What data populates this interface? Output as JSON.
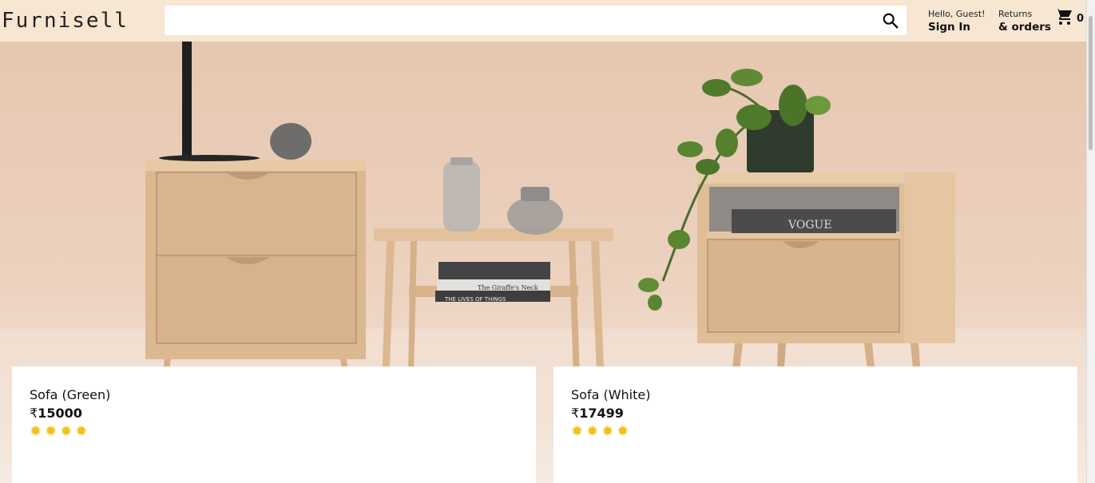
{
  "header": {
    "logo": "Furnisell",
    "search": {
      "value": "",
      "placeholder": ""
    },
    "signin": {
      "line1": "Hello, Guest!",
      "line2": "Sign In"
    },
    "returns": {
      "line1": "Returns",
      "line2": "& orders"
    },
    "cart": {
      "count": "0"
    }
  },
  "hero": {
    "books_a": "THE LIVES OF THINGS",
    "books_b": "The Giraffe's Neck",
    "magazine": "VOGUE"
  },
  "products": [
    {
      "title": "Sofa (Green)",
      "currency": "₹",
      "price": "15000",
      "rating_icons": [
        "sun-star",
        "sun-star",
        "sun-star",
        "sun-star"
      ]
    },
    {
      "title": "Sofa (White)",
      "currency": "₹",
      "price": "17499",
      "rating_icons": [
        "sun-star",
        "sun-star",
        "sun-star",
        "sun-star"
      ]
    }
  ],
  "colors": {
    "header_bg": "#f7e6d2",
    "hero_bg": "#e6c7b1",
    "wood": "#e0bd98",
    "star": "#f0c21b"
  }
}
